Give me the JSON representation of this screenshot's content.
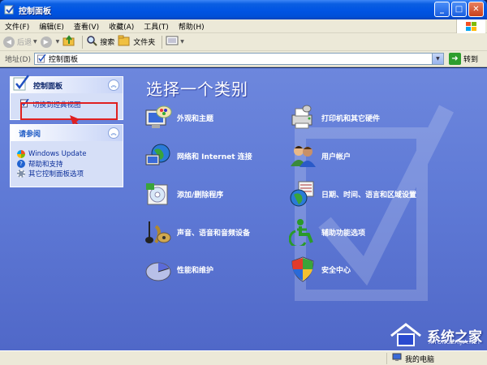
{
  "window": {
    "title": "控制面板",
    "buttons": {
      "minimize": "_",
      "maximize": "□",
      "close": "✕"
    }
  },
  "menu": [
    "文件(F)",
    "编辑(E)",
    "查看(V)",
    "收藏(A)",
    "工具(T)",
    "帮助(H)"
  ],
  "toolbar": {
    "back": "后退",
    "search": "搜索",
    "folders": "文件夹"
  },
  "address": {
    "label": "地址(D)",
    "value": "控制面板",
    "go": "转到"
  },
  "pane_control": {
    "title": "控制面板",
    "link": "切换到经典视图"
  },
  "pane_see_also": {
    "title": "请参阅",
    "links": [
      "Windows Update",
      "帮助和支持",
      "其它控制面板选项"
    ]
  },
  "heading": "选择一个类别",
  "categories": [
    {
      "label": "外观和主题",
      "icon": "appearance-themes-icon"
    },
    {
      "label": "打印机和其它硬件",
      "icon": "printer-hardware-icon"
    },
    {
      "label": "网络和 Internet 连接",
      "icon": "network-internet-icon"
    },
    {
      "label": "用户帐户",
      "icon": "user-accounts-icon"
    },
    {
      "label": "添加/删除程序",
      "icon": "add-remove-programs-icon"
    },
    {
      "label": "日期、时间、语言和区域设置",
      "icon": "date-time-language-icon"
    },
    {
      "label": "声音、语音和音频设备",
      "icon": "sound-audio-icon"
    },
    {
      "label": "辅助功能选项",
      "icon": "accessibility-icon"
    },
    {
      "label": "性能和维护",
      "icon": "performance-maintenance-icon"
    },
    {
      "label": "安全中心",
      "icon": "security-center-icon"
    }
  ],
  "status": {
    "location": "我的电脑"
  },
  "watermark": {
    "name": "系统之家",
    "url": "XITONGZHIJIA.NET"
  },
  "colors": {
    "titlebar": "#0054e3",
    "content_bg": "#6d87dd",
    "highlight": "#e02020"
  }
}
